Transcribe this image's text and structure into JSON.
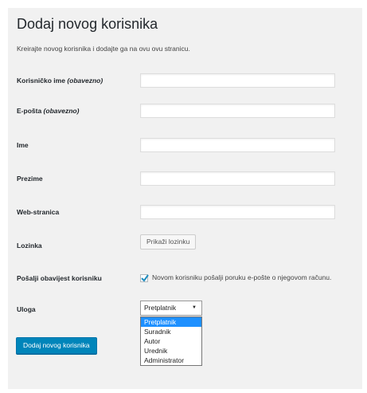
{
  "page": {
    "title": "Dodaj novog korisnika",
    "description": "Kreirajte novog korisnika i dodajte ga na ovu ovu stranicu."
  },
  "fields": {
    "username": {
      "label": "Korisničko ime",
      "required": "(obavezno)",
      "value": ""
    },
    "email": {
      "label": "E-pošta",
      "required": "(obavezno)",
      "value": ""
    },
    "first_name": {
      "label": "Ime",
      "value": ""
    },
    "last_name": {
      "label": "Prezime",
      "value": ""
    },
    "website": {
      "label": "Web-stranica",
      "value": ""
    },
    "password": {
      "label": "Lozinka",
      "button": "Prikaži lozinku"
    },
    "notify": {
      "label": "Pošalji obavijest korisniku",
      "checkbox_label": "Novom korisniku pošalji poruku e-pošte o njegovom računu.",
      "checked": true
    },
    "role": {
      "label": "Uloga",
      "selected": "Pretplatnik",
      "options": [
        "Pretplatnik",
        "Suradnik",
        "Autor",
        "Urednik",
        "Administrator"
      ]
    }
  },
  "submit_label": "Dodaj novog korisnika",
  "colors": {
    "primary_button": "#0085ba",
    "option_highlight": "#1e90ff",
    "panel_background": "#f1f1f1"
  }
}
